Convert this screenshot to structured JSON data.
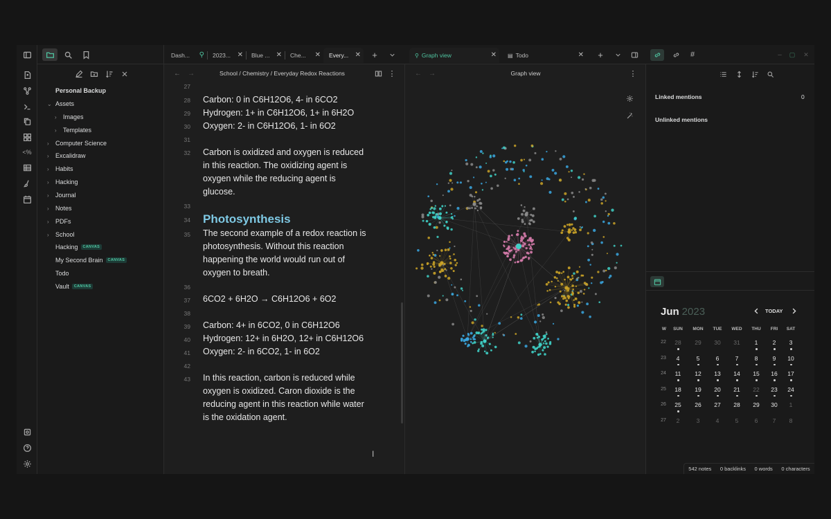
{
  "sidebar": {
    "vault_name": "Personal Backup",
    "items": [
      {
        "label": "Assets",
        "depth": 0,
        "expanded": true
      },
      {
        "label": "Images",
        "depth": 1,
        "expanded": false
      },
      {
        "label": "Templates",
        "depth": 1,
        "expanded": false
      },
      {
        "label": "Computer Science",
        "depth": 0,
        "expanded": false
      },
      {
        "label": "Excalidraw",
        "depth": 0,
        "expanded": false
      },
      {
        "label": "Habits",
        "depth": 0,
        "expanded": false
      },
      {
        "label": "Hacking",
        "depth": 0,
        "expanded": false
      },
      {
        "label": "Journal",
        "depth": 0,
        "expanded": false
      },
      {
        "label": "Notes",
        "depth": 0,
        "expanded": false
      },
      {
        "label": "PDFs",
        "depth": 0,
        "expanded": false
      },
      {
        "label": "School",
        "depth": 0,
        "expanded": false
      },
      {
        "label": "Hacking",
        "depth": 0,
        "file": true,
        "badge": "CANVAS"
      },
      {
        "label": "My Second Brain",
        "depth": 0,
        "file": true,
        "badge": "CANVAS"
      },
      {
        "label": "Todo",
        "depth": 0,
        "file": true
      },
      {
        "label": "Vault",
        "depth": 0,
        "file": true,
        "badge": "CANVAS"
      }
    ]
  },
  "editor": {
    "tabs": [
      {
        "label": "Dash...",
        "pinned": true
      },
      {
        "label": "2023..."
      },
      {
        "label": "Blue ..."
      },
      {
        "label": "Che..."
      },
      {
        "label": "Every...",
        "active": true
      }
    ],
    "breadcrumb": "School / Chemistry / Everyday Redox Reactions",
    "lines": [
      {
        "n": "27",
        "text": ""
      },
      {
        "n": "28",
        "text": "Carbon: 0 in C6H12O6, 4- in 6CO2"
      },
      {
        "n": "29",
        "text": "Hydrogen: 1+ in C6H12O6, 1+ in 6H2O"
      },
      {
        "n": "30",
        "text": "Oxygen: 2- in C6H12O6, 1- in 6O2"
      },
      {
        "n": "31",
        "text": ""
      },
      {
        "n": "32",
        "text": "Carbon is oxidized and oxygen is reduced",
        "wrap": [
          "in this reaction. The oxidizing agent is",
          "oxygen while the reducing agent is",
          "glucose."
        ]
      },
      {
        "n": "33",
        "text": ""
      },
      {
        "n": "34",
        "text": "Photosynthesis",
        "heading": true
      },
      {
        "n": "35",
        "text": "The second example of a redox reaction is",
        "wrap": [
          "photosynthesis. Without this reaction",
          "happening the world would run out of",
          "oxygen to breath."
        ]
      },
      {
        "n": "36",
        "text": ""
      },
      {
        "n": "37",
        "text": "6CO2 + 6H2O → C6H12O6 + 6O2"
      },
      {
        "n": "38",
        "text": ""
      },
      {
        "n": "39",
        "text": "Carbon: 4+ in 6CO2, 0 in C6H12O6"
      },
      {
        "n": "40",
        "text": "Hydrogen: 12+ in 6H2O, 12+ in C6H12O6"
      },
      {
        "n": "41",
        "text": "Oxygen: 2- in 6CO2, 1- in 6O2"
      },
      {
        "n": "42",
        "text": ""
      },
      {
        "n": "43",
        "text": "In this reaction, carbon is reduced while",
        "wrap": [
          "oxygen is oxidized. Caron dioxide is the",
          "reducing agent in this reaction while water",
          "is the oxidation agent."
        ]
      }
    ]
  },
  "graph": {
    "tabs": [
      {
        "label": "Graph view",
        "active": true
      },
      {
        "label": "Todo"
      }
    ],
    "title": "Graph view",
    "colors": {
      "teal": "#3fd0c6",
      "blue": "#3aa7e0",
      "gold": "#c9a227",
      "pink": "#d57bab",
      "gray": "#8a8a8a"
    }
  },
  "right": {
    "linked_label": "Linked mentions",
    "linked_count": "0",
    "unlinked_label": "Unlinked mentions",
    "calendar": {
      "month": "Jun",
      "year": "2023",
      "today_label": "TODAY",
      "weekdays": [
        "W",
        "SUN",
        "MON",
        "TUE",
        "WED",
        "THU",
        "FRI",
        "SAT"
      ],
      "weeks": [
        {
          "wk": "22",
          "days": [
            "28",
            "29",
            "30",
            "31",
            "1",
            "2",
            "3"
          ],
          "dim": [
            true,
            true,
            true,
            true,
            false,
            false,
            false
          ]
        },
        {
          "wk": "23",
          "days": [
            "4",
            "5",
            "6",
            "7",
            "8",
            "9",
            "10"
          ],
          "dim": [
            false,
            false,
            false,
            false,
            false,
            false,
            false
          ]
        },
        {
          "wk": "24",
          "days": [
            "11",
            "12",
            "13",
            "14",
            "15",
            "16",
            "17"
          ],
          "dim": [
            false,
            false,
            false,
            false,
            false,
            false,
            false
          ]
        },
        {
          "wk": "25",
          "days": [
            "18",
            "19",
            "20",
            "21",
            "22",
            "23",
            "24"
          ],
          "dim": [
            false,
            false,
            false,
            false,
            true,
            false,
            false
          ]
        },
        {
          "wk": "26",
          "days": [
            "25",
            "26",
            "27",
            "28",
            "29",
            "30",
            "1"
          ],
          "dim": [
            false,
            false,
            false,
            false,
            false,
            false,
            true
          ]
        },
        {
          "wk": "27",
          "days": [
            "2",
            "3",
            "4",
            "5",
            "6",
            "7",
            "8"
          ],
          "dim": [
            true,
            true,
            true,
            true,
            true,
            true,
            true
          ]
        }
      ]
    }
  },
  "status": {
    "notes": "542 notes",
    "backlinks": "0 backlinks",
    "words": "0 words",
    "characters": "0 characters"
  }
}
